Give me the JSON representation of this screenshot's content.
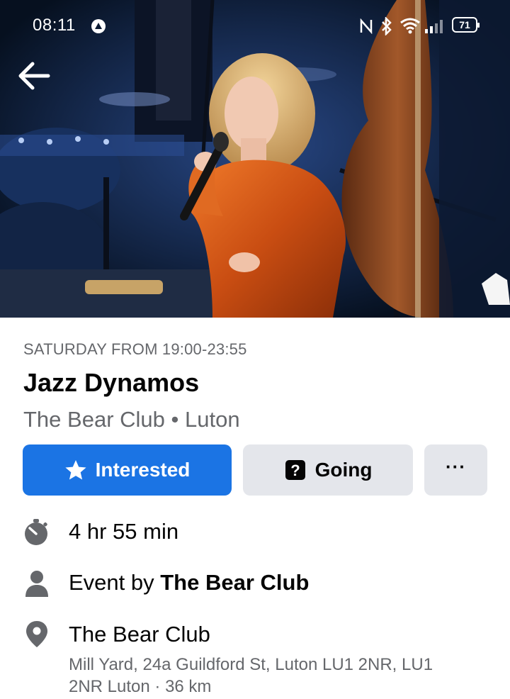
{
  "status_bar": {
    "time": "08:11",
    "battery": "71",
    "icons": [
      "notification-icon",
      "nfc-icon",
      "bluetooth-icon",
      "wifi-icon",
      "signal-icon",
      "battery-icon"
    ]
  },
  "hero": {
    "description_icon": "event-cover-photo",
    "navigation": {
      "back_icon": "back-arrow-icon"
    }
  },
  "event": {
    "date_time": "SATURDAY FROM 19:00-23:55",
    "title": "Jazz Dynamos",
    "venue": "The Bear Club",
    "separator": "•",
    "city": "Luton"
  },
  "actions": {
    "interested_label": "Interested",
    "interested_icon": "star-icon",
    "going_label": "Going",
    "going_icon": "question-icon",
    "more_label": "···",
    "more_icon": "more-icon"
  },
  "details": {
    "duration": "4 hr 55 min",
    "duration_icon": "stopwatch-icon",
    "event_by_prefix": "Event by",
    "event_by_name": "The Bear Club",
    "host_icon": "person-icon",
    "location_name": "The Bear Club",
    "location_icon": "location-pin-icon",
    "address": "Mill Yard, 24a Guildford St, Luton LU1 2NR, LU1 2NR Luton · 36 km"
  },
  "colors": {
    "accent": "#1b74e4",
    "secondary_button": "#e4e6eb",
    "muted_text": "#65676b",
    "primary_text": "#050505",
    "dress": "#d0571a"
  }
}
